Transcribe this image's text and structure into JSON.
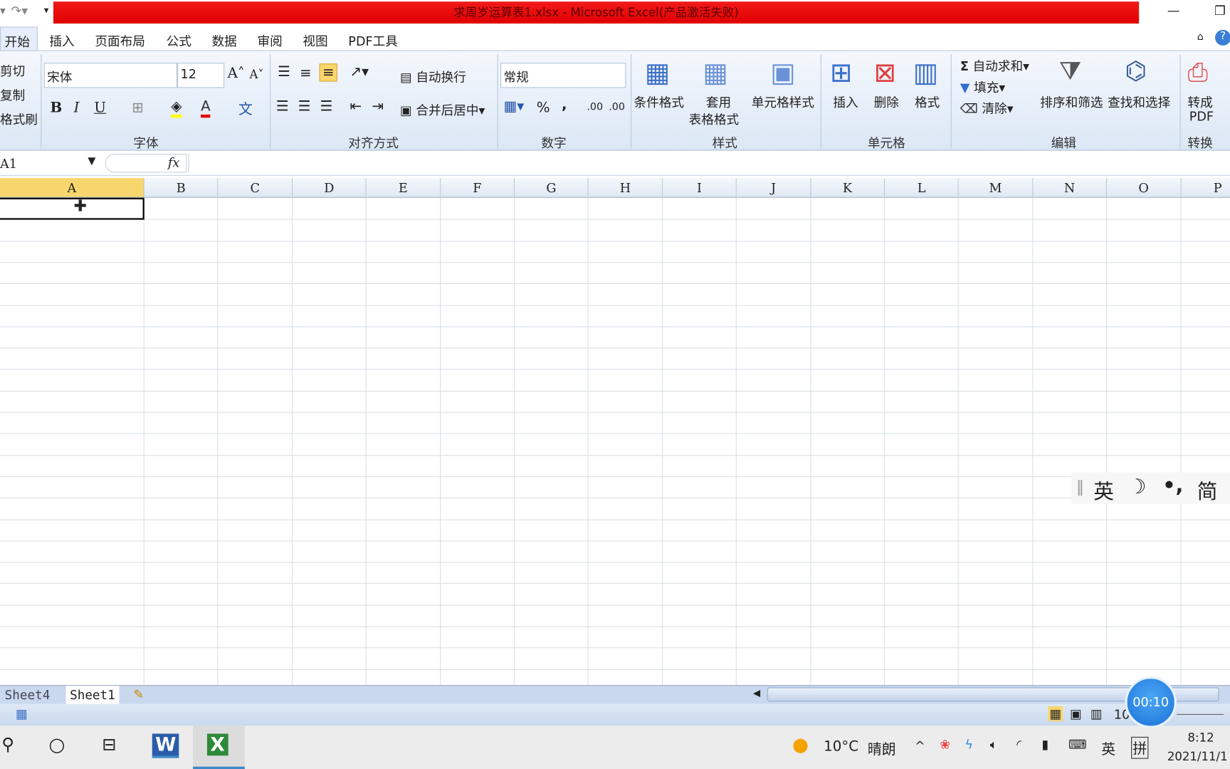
{
  "window": {
    "title": "求周岁运算表1.xlsx - Microsoft Excel(产品激活失败)",
    "minimize": "—",
    "restore": "❐"
  },
  "tabs": [
    "开始",
    "插入",
    "页面布局",
    "公式",
    "数据",
    "审阅",
    "视图",
    "PDF工具"
  ],
  "clipboard": {
    "cut": "剪切",
    "copy": "复制",
    "painter": "格式刷"
  },
  "font": {
    "name": "宋体",
    "size": "12",
    "group": "字体",
    "bold": "B",
    "italic": "I",
    "underline": "U"
  },
  "alignment": {
    "wrap": "自动换行",
    "merge": "合并后居中",
    "group": "对齐方式"
  },
  "number": {
    "format": "常规",
    "percent": "%",
    "comma": ",",
    "group": "数字"
  },
  "styles": {
    "conditional": "条件格式",
    "table1": "套用",
    "table2": "表格格式",
    "cell": "单元格样式",
    "group": "样式"
  },
  "cells": {
    "insert": "插入",
    "delete": "删除",
    "format": "格式",
    "group": "单元格"
  },
  "editing": {
    "autosum": "自动求和",
    "fill": "填充",
    "clear": "清除",
    "sort": "排序和筛选",
    "find": "查找和选择",
    "group": "编辑"
  },
  "convert": {
    "label1": "转成",
    "label2": "PDF",
    "group": "转换"
  },
  "formula_bar": {
    "name_box": "A1",
    "fx": "fx",
    "value": ""
  },
  "columns": [
    "A",
    "B",
    "C",
    "D",
    "E",
    "F",
    "G",
    "H",
    "I",
    "J",
    "K",
    "L",
    "M",
    "N",
    "O",
    "P"
  ],
  "selected_cell": "A1",
  "sheets": [
    "Sheet4",
    "Sheet1"
  ],
  "status": {
    "zoom": "10"
  },
  "ime": {
    "lang": "英",
    "moon": "☽",
    "punct": "•,",
    "mode": "简"
  },
  "timer": "00:10",
  "taskbar": {
    "weather_temp": "10°C",
    "weather_desc": "晴朗",
    "ime_lang": "英",
    "ime_mode": "拼",
    "time": "8:12",
    "date": "2021/11/1"
  },
  "colors": {
    "title_bar": "#e60000",
    "selected_header": "#f8d66e",
    "accent": "#1c73d8"
  }
}
